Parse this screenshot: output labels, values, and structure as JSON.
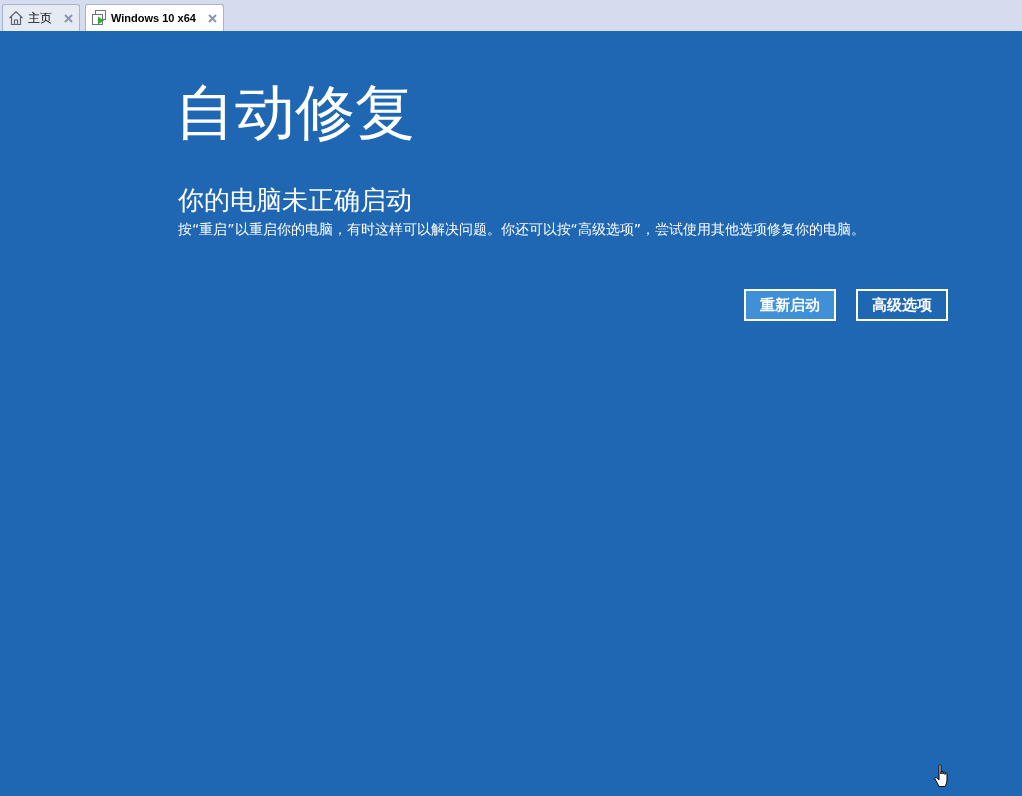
{
  "tabs": [
    {
      "kind": "home",
      "label": "主页",
      "selected": false
    },
    {
      "kind": "vm",
      "label": "Windows 10 x64",
      "selected": true
    }
  ],
  "screen": {
    "title": "自动修复",
    "heading": "你的电脑未正确启动",
    "message": "按“重启”以重启你的电脑，有时这样可以解决问题。你还可以按“高级选项”，尝试使用其他选项修复你的电脑。",
    "buttons": [
      {
        "label": "重新启动",
        "selected": true
      },
      {
        "label": "高级选项",
        "selected": false
      }
    ]
  }
}
